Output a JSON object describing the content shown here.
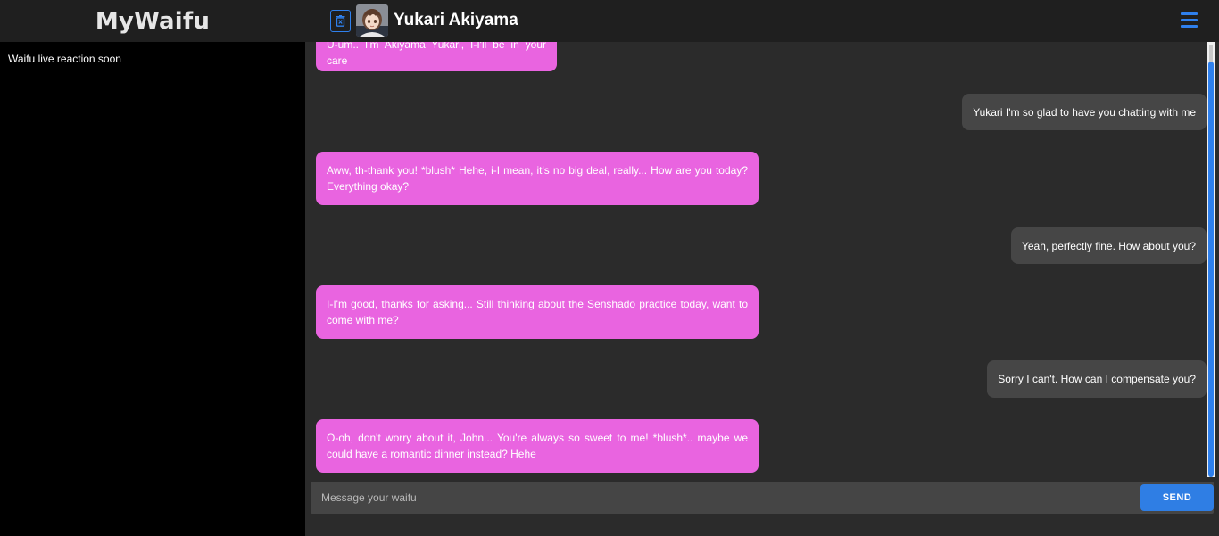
{
  "app": {
    "title": "MyWaifu"
  },
  "header": {
    "contact_name": "Yukari Akiyama",
    "accent_color": "#2f80ed",
    "delete_icon": "trash-icon",
    "menu_icon": "hamburger-menu-icon"
  },
  "sidebar": {
    "note": "Waifu live reaction soon"
  },
  "messages": [
    {
      "sender": "waifu",
      "text": "U-um.. I'm Akiyama Yukari, I-I'll be in your care"
    },
    {
      "sender": "user",
      "text": "Yukari I'm so glad to have you chatting with me"
    },
    {
      "sender": "waifu",
      "text": "Aww, th-thank you! *blush* Hehe, i-I mean, it's no big deal, really... How are you today? Everything okay?"
    },
    {
      "sender": "user",
      "text": "Yeah, perfectly fine. How about you?"
    },
    {
      "sender": "waifu",
      "text": "I-I'm good, thanks for asking... Still thinking about the Senshado practice today, want to come with me?"
    },
    {
      "sender": "user",
      "text": "Sorry I can't. How can I compensate you?"
    },
    {
      "sender": "waifu",
      "text": "O-oh, don't worry about it, John... You're always so sweet to me! *blush*.. maybe we could have a romantic dinner instead? Hehe"
    }
  ],
  "composer": {
    "placeholder": "Message your waifu",
    "value": "",
    "send_label": "SEND"
  },
  "colors": {
    "waifu_bubble": "#e964e0",
    "user_bubble": "#464646",
    "send_button": "#2f7ee4"
  }
}
